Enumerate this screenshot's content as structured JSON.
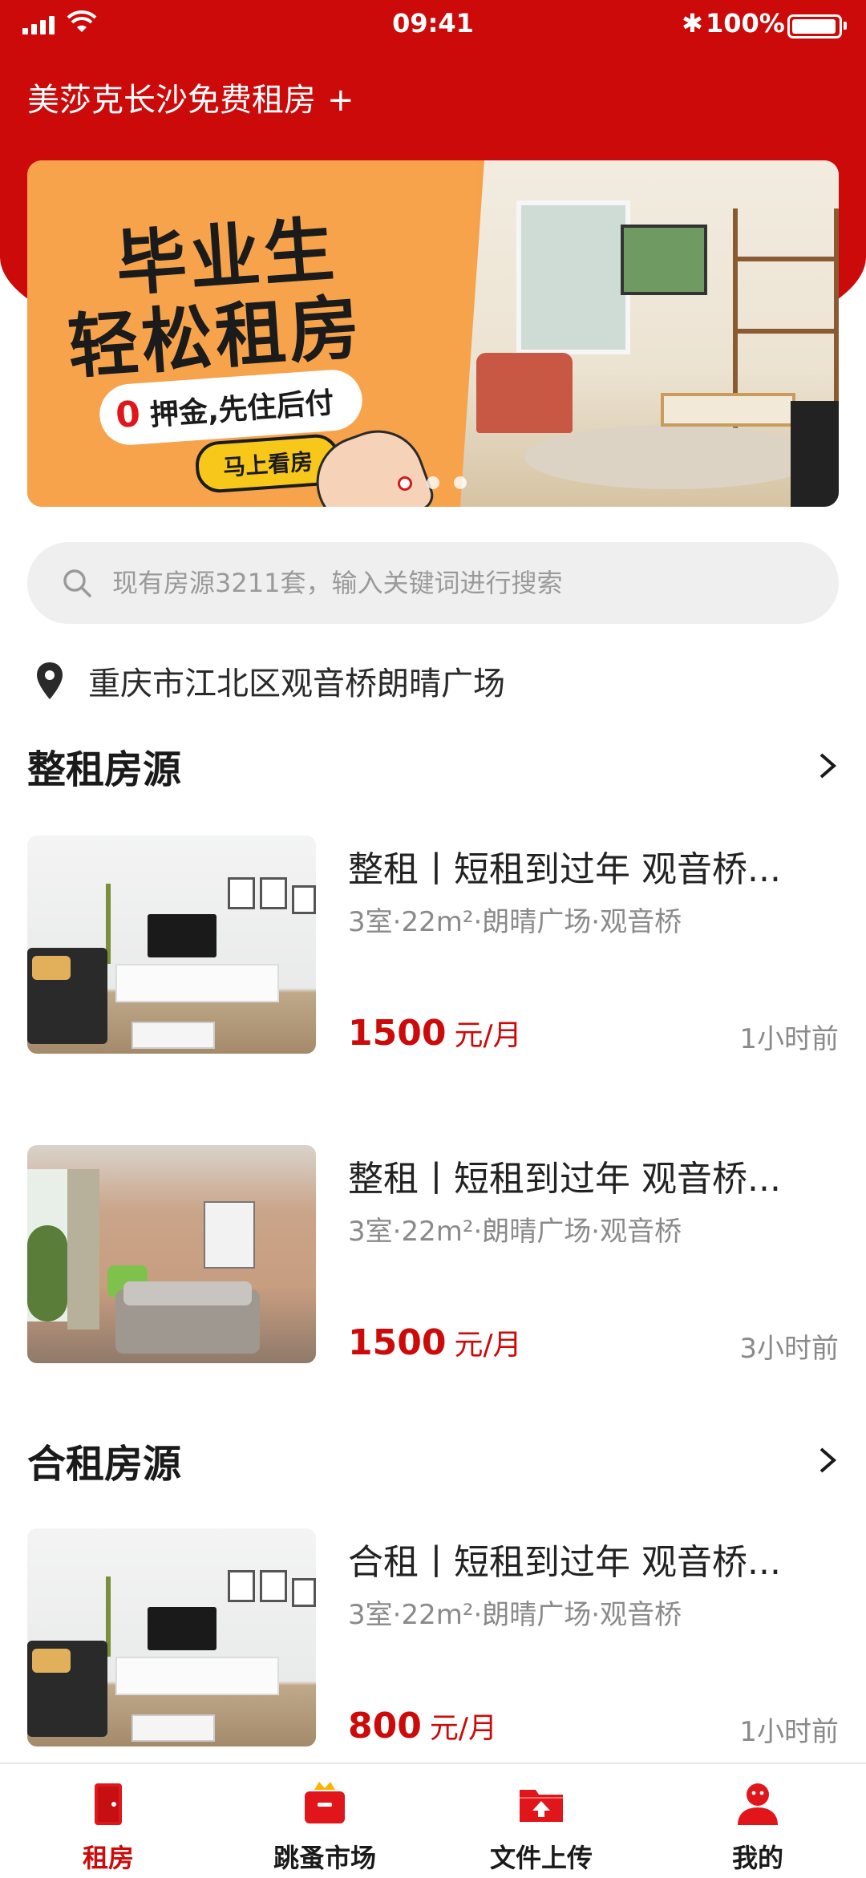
{
  "status_bar": {
    "time": "09:41",
    "battery": "100%",
    "bluetooth": "✱"
  },
  "app": {
    "title": "美莎克长沙免费租房",
    "title_plus": "+"
  },
  "banner": {
    "line1": "毕业生",
    "line2": "轻松租房",
    "pill_zero": "0",
    "pill_text": "押金,先住后付",
    "cta": "马上看房",
    "dots": 3,
    "active_dot": 0
  },
  "search": {
    "placeholder": "现有房源3211套，输入关键词进行搜索",
    "icon": "search-icon"
  },
  "location": {
    "text": "重庆市江北区观音桥朗晴广场",
    "icon": "location-pin-icon"
  },
  "sections": {
    "whole": {
      "title": "整租房源"
    },
    "shared": {
      "title": "合租房源"
    }
  },
  "listings": [
    {
      "title": "整租丨短租到过年 观音桥...",
      "meta": "3室·22m²·朗晴广场·观音桥",
      "price": "1500",
      "unit": "元/月",
      "time": "1小时前"
    },
    {
      "title": "整租丨短租到过年 观音桥...",
      "meta": "3室·22m²·朗晴广场·观音桥",
      "price": "1500",
      "unit": "元/月",
      "time": "3小时前"
    },
    {
      "title": "合租丨短租到过年 观音桥...",
      "meta": "3室·22m²·朗晴广场·观音桥",
      "price": "800",
      "unit": "元/月",
      "time": "1小时前"
    }
  ],
  "tabs": [
    {
      "label": "租房",
      "icon": "door-icon",
      "active": true
    },
    {
      "label": "跳蚤市场",
      "icon": "shopping-basket-icon",
      "active": false
    },
    {
      "label": "文件上传",
      "icon": "folder-upload-icon",
      "active": false
    },
    {
      "label": "我的",
      "icon": "user-icon",
      "active": false
    }
  ],
  "colors": {
    "brand": "#cc0a0a",
    "banner_orange": "#f7a34c",
    "cta_yellow": "#f7c81a"
  }
}
